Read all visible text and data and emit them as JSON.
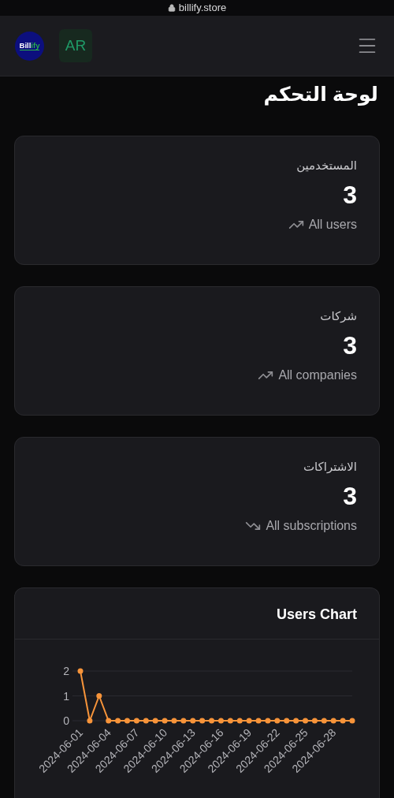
{
  "browser": {
    "url": "billify.store"
  },
  "header": {
    "logo": [
      "Bill",
      "ify"
    ],
    "language": "AR"
  },
  "title": "لوحة التحكم",
  "stats": [
    {
      "label": "المستخدمين",
      "value": "3",
      "caption": "All users",
      "trend_up": true
    },
    {
      "label": "شركات",
      "value": "3",
      "caption": "All companies",
      "trend_up": true
    },
    {
      "label": "الاشتراكات",
      "value": "3",
      "caption": "All subscriptions",
      "trend_up": false
    }
  ],
  "chart": {
    "title": "Users Chart",
    "chart_data": {
      "type": "line",
      "categories": [
        "2024-06-01",
        null,
        null,
        "2024-06-04",
        null,
        null,
        "2024-06-07",
        null,
        null,
        "2024-06-10",
        null,
        null,
        "2024-06-13",
        null,
        null,
        "2024-06-16",
        null,
        null,
        "2024-06-19",
        null,
        null,
        "2024-06-22",
        null,
        null,
        "2024-06-25",
        null,
        null,
        "2024-06-28",
        null,
        null
      ],
      "series": [
        {
          "color": "#f7943a",
          "marker": "circle",
          "values": [
            2,
            0,
            1,
            0,
            0,
            0,
            0,
            0,
            0,
            0,
            0,
            0,
            0,
            0,
            0,
            0,
            0,
            0,
            0,
            0,
            0,
            0,
            0,
            0,
            0,
            0,
            0,
            0,
            0,
            0
          ]
        }
      ],
      "ylim": [
        0,
        2
      ],
      "yticks": [
        0,
        1,
        2
      ]
    }
  }
}
